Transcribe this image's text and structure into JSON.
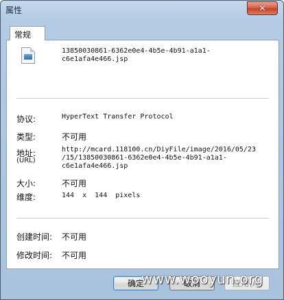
{
  "window": {
    "title": "属性",
    "close_symbol": "✕"
  },
  "tabs": [
    {
      "label": "常规"
    }
  ],
  "file": {
    "icon": "image-file-icon",
    "name_line1": "13850030861-6362e0e4-4b5e-4b91-a1a1-",
    "name_line2": "c6e1afa4e466.jsp"
  },
  "properties": {
    "protocol": {
      "label": "协议:",
      "value": "HyperText Transfer Protocol"
    },
    "type": {
      "label": "类型:",
      "value": "不可用"
    },
    "address": {
      "label": "地址:",
      "sublabel": "(URL)",
      "line1": "http://mcard.118100.cn/DiyFile/image/2016/05/23",
      "line2": "/15/13850030861-6362e0e4-4b5e-4b91-a1a1-",
      "line3": "c6e1afa4e466.jsp"
    },
    "size": {
      "label": "大小:",
      "value": "不可用"
    },
    "dimensions": {
      "label": "维度:",
      "value": "144  x  144  pixels"
    },
    "created": {
      "label": "创建时间:",
      "value": "不可用"
    },
    "modified": {
      "label": "修改时间:",
      "value": "不可用"
    }
  },
  "buttons": {
    "ok": "确定",
    "cancel": "取消",
    "apply": "应用(A)"
  },
  "watermark": "www.wooyun.org"
}
